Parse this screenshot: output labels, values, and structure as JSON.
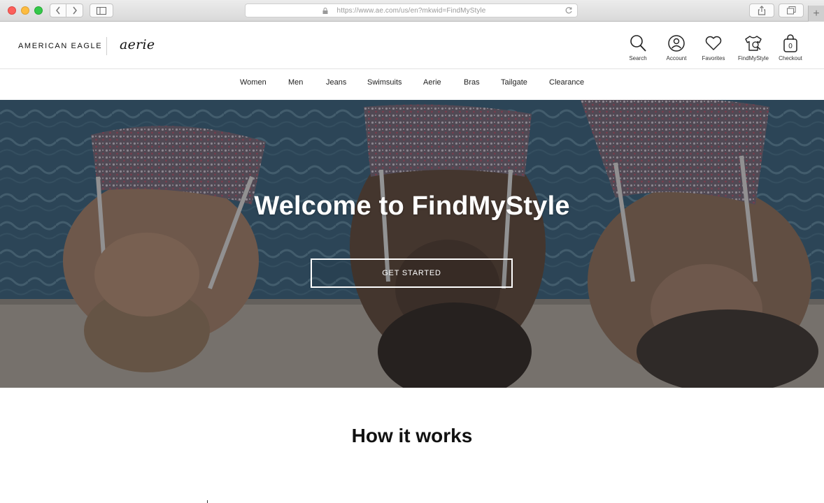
{
  "browser": {
    "url": "https://www.ae.com/us/en?mkwid=FindMyStyle",
    "newtab_label": "+"
  },
  "header": {
    "brand_ae": "AMERICAN EAGLE",
    "brand_aerie": "aerie",
    "utilities": [
      {
        "label": "Search",
        "icon": "search-icon"
      },
      {
        "label": "Account",
        "icon": "account-icon"
      },
      {
        "label": "Favorites",
        "icon": "heart-icon"
      },
      {
        "label": "FindMyStyle",
        "icon": "shirt-icon"
      },
      {
        "label": "Checkout",
        "icon": "bag-icon"
      }
    ],
    "cart_count": "0"
  },
  "nav": {
    "items": [
      "Women",
      "Men",
      "Jeans",
      "Swimsuits",
      "Aerie",
      "Bras",
      "Tailgate",
      "Clearance"
    ]
  },
  "hero": {
    "title": "Welcome to FindMyStyle",
    "cta": "GET STARTED"
  },
  "how_it_works": {
    "title": "How it works"
  },
  "colors": {
    "text": "#222222",
    "hero_overlay": "#3c5769",
    "white": "#ffffff"
  }
}
